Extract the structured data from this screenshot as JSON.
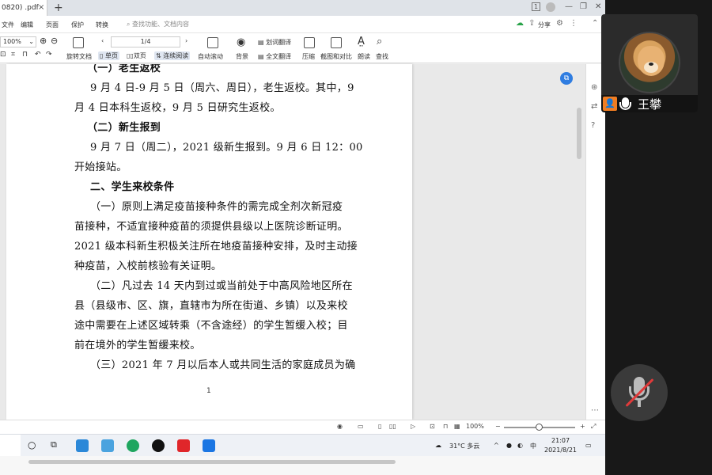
{
  "tab": {
    "title": "0820) .pdf",
    "close": "×",
    "new": "+"
  },
  "window_controls": {
    "win_badge": "1",
    "minimize": "—",
    "restore": "❐",
    "close": "✕"
  },
  "menu": {
    "items": [
      "文件",
      "编辑",
      "页面",
      "保护",
      "转换"
    ],
    "search_placeholder": "查找功能、文档内容",
    "share": "分享"
  },
  "toolbar": {
    "zoom": "100%",
    "page_indicator": "1/4",
    "rotate": "旋转文档",
    "single_page": "单页",
    "double_page": "双页",
    "continuous": "连续阅读",
    "auto_scroll": "自动滚动",
    "background": "背景",
    "word_translate": "划词翻译",
    "full_translate": "全文翻译",
    "compress": "压缩",
    "screenshot_compare": "截图和对比",
    "read_aloud": "朗读",
    "find": "查找"
  },
  "document": {
    "lines": [
      {
        "text": "（一）老生返校",
        "bold": true
      },
      {
        "text": "9 月 4 日-9 月 5 日（周六、周日），老生返校。其中，9",
        "bold": false
      },
      {
        "text": "月 4 日本科生返校，9 月 5 日研究生返校。",
        "bold": false
      },
      {
        "text": "（二）新生报到",
        "bold": true
      },
      {
        "text": "9 月 7 日（周二），2021 级新生报到。9 月 6 日 12：00",
        "bold": false
      },
      {
        "text": "开始接站。",
        "bold": false
      },
      {
        "text": "二、学生来校条件",
        "bold": true
      },
      {
        "text": "（一）原则上满足疫苗接种条件的需完成全剂次新冠疫",
        "bold": false
      },
      {
        "text": "苗接种，不适宜接种疫苗的须提供县级以上医院诊断证明。",
        "bold": false
      },
      {
        "text": "2021 级本科新生积极关注所在地疫苗接种安排，及时主动接",
        "bold": false
      },
      {
        "text": "种疫苗，入校前核验有关证明。",
        "bold": false
      },
      {
        "text": "（二）凡过去 14 天内到过或当前处于中高风险地区所在",
        "bold": false
      },
      {
        "text": "县（县级市、区、旗，直辖市为所在街道、乡镇）以及来校",
        "bold": false
      },
      {
        "text": "途中需要在上述区域转乘（不含途经）的学生暂缓入校；目",
        "bold": false
      },
      {
        "text": "前在境外的学生暂缓来校。",
        "bold": false
      },
      {
        "text": "（三）2021 年 7 月以后本人或共同生活的家庭成员为确",
        "bold": false
      }
    ],
    "page_number": "1"
  },
  "statusbar": {
    "zoom": "100%",
    "minus": "−",
    "plus": "+"
  },
  "taskbar": {
    "weather": "31°C 多云",
    "ime": "中",
    "time": "21:07",
    "date": "2021/8/21"
  },
  "meeting": {
    "participant_name": "王攀",
    "colors": {
      "person_badge": "#f07d22",
      "muted_slash": "#e03a3a"
    }
  },
  "icons": {
    "search": "search-icon",
    "rotate": "rotate-icon",
    "mic_muted": "mic-muted-icon"
  }
}
